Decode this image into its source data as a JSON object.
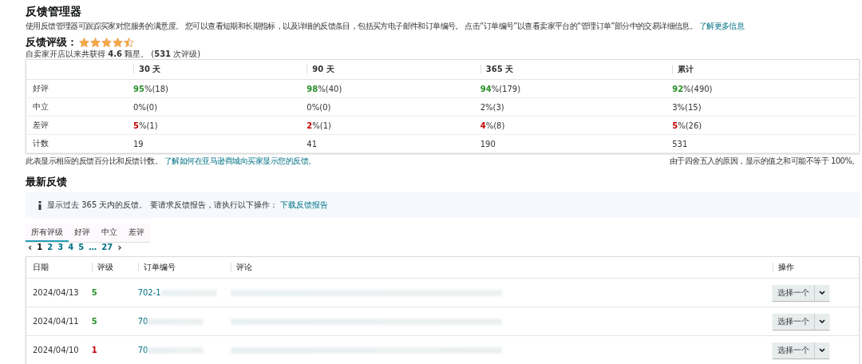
{
  "title": "反馈管理器",
  "description": {
    "text": "使用反馈管理器可跟踪买家对您服务的满意度。 您可以查看短期和长期指标，以及详细的反馈条目，包括买方电子邮件和订单编号。 点击“订单编号”以查看卖家平台的“管理订单”部分中的交易详细信息。",
    "link": "了解更多信息"
  },
  "rating": {
    "label": "反馈评级：",
    "stars": 4.5,
    "summary": "自卖家开店以来共获得 **4.6** 颗星。 (**531** 次评级)"
  },
  "summary_table": {
    "columns": [
      "30 天",
      "90 天",
      "365 天",
      "累计"
    ],
    "rows": [
      {
        "label": "好评",
        "kind": "positive",
        "cells": [
          {
            "pct": "95",
            "count": "%(18)"
          },
          {
            "pct": "98",
            "count": "%(40)"
          },
          {
            "pct": "94",
            "count": "%(179)"
          },
          {
            "pct": "92",
            "count": "%(490)"
          }
        ]
      },
      {
        "label": "中立",
        "kind": "neutral",
        "cells": [
          {
            "pct": "0",
            "count": "%(0)"
          },
          {
            "pct": "0",
            "count": "%(0)"
          },
          {
            "pct": "2",
            "count": "%(3)"
          },
          {
            "pct": "3",
            "count": "%(15)"
          }
        ]
      },
      {
        "label": "差评",
        "kind": "negative",
        "cells": [
          {
            "pct": "5",
            "count": "%(1)"
          },
          {
            "pct": "2",
            "count": "%(1)"
          },
          {
            "pct": "4",
            "count": "%(8)"
          },
          {
            "pct": "5",
            "count": "%(26)"
          }
        ]
      },
      {
        "label": "计数",
        "kind": "count",
        "cells": [
          {
            "pct": "19"
          },
          {
            "pct": "41"
          },
          {
            "pct": "190"
          },
          {
            "pct": "531"
          }
        ]
      }
    ]
  },
  "footnote": {
    "text": "此表显示相应的反馈百分比和反馈计数。",
    "link": "了解如何在亚马逊商城向买家显示您的反馈。",
    "right": "由于四舍五入的原因，显示的值之和可能不等于 100%。"
  },
  "recent": {
    "heading": "最新反馈",
    "notice": {
      "text": "显示过去 365 天内的反馈。 要请求反馈报告，请执行以下操作：",
      "link": "下载反馈报告"
    },
    "tabs": [
      {
        "label": "所有评级",
        "selected": true
      },
      {
        "label": "好评",
        "selected": false
      },
      {
        "label": "中立",
        "selected": false
      },
      {
        "label": "差评",
        "selected": false
      }
    ],
    "pagination": {
      "prev": "‹",
      "pages": [
        {
          "label": "1",
          "selected": true
        },
        {
          "label": "2",
          "selected": false
        },
        {
          "label": "3",
          "selected": false
        },
        {
          "label": "4",
          "selected": false
        },
        {
          "label": "5",
          "selected": false
        },
        {
          "label": "…",
          "selected": false
        },
        {
          "label": "27",
          "selected": false
        }
      ],
      "next": "›"
    },
    "columns": [
      "日期",
      "评级",
      "订单编号",
      "评论",
      "操作"
    ],
    "rows": [
      {
        "date": "2024/04/13",
        "rating": "5",
        "kind": "positive",
        "order": "702-1",
        "action": "选择一个"
      },
      {
        "date": "2024/04/11",
        "rating": "5",
        "kind": "positive",
        "order": "70",
        "action": "选择一个"
      },
      {
        "date": "2024/04/10",
        "rating": "1",
        "kind": "negative",
        "order": "70",
        "action": "选择一个"
      }
    ]
  }
}
